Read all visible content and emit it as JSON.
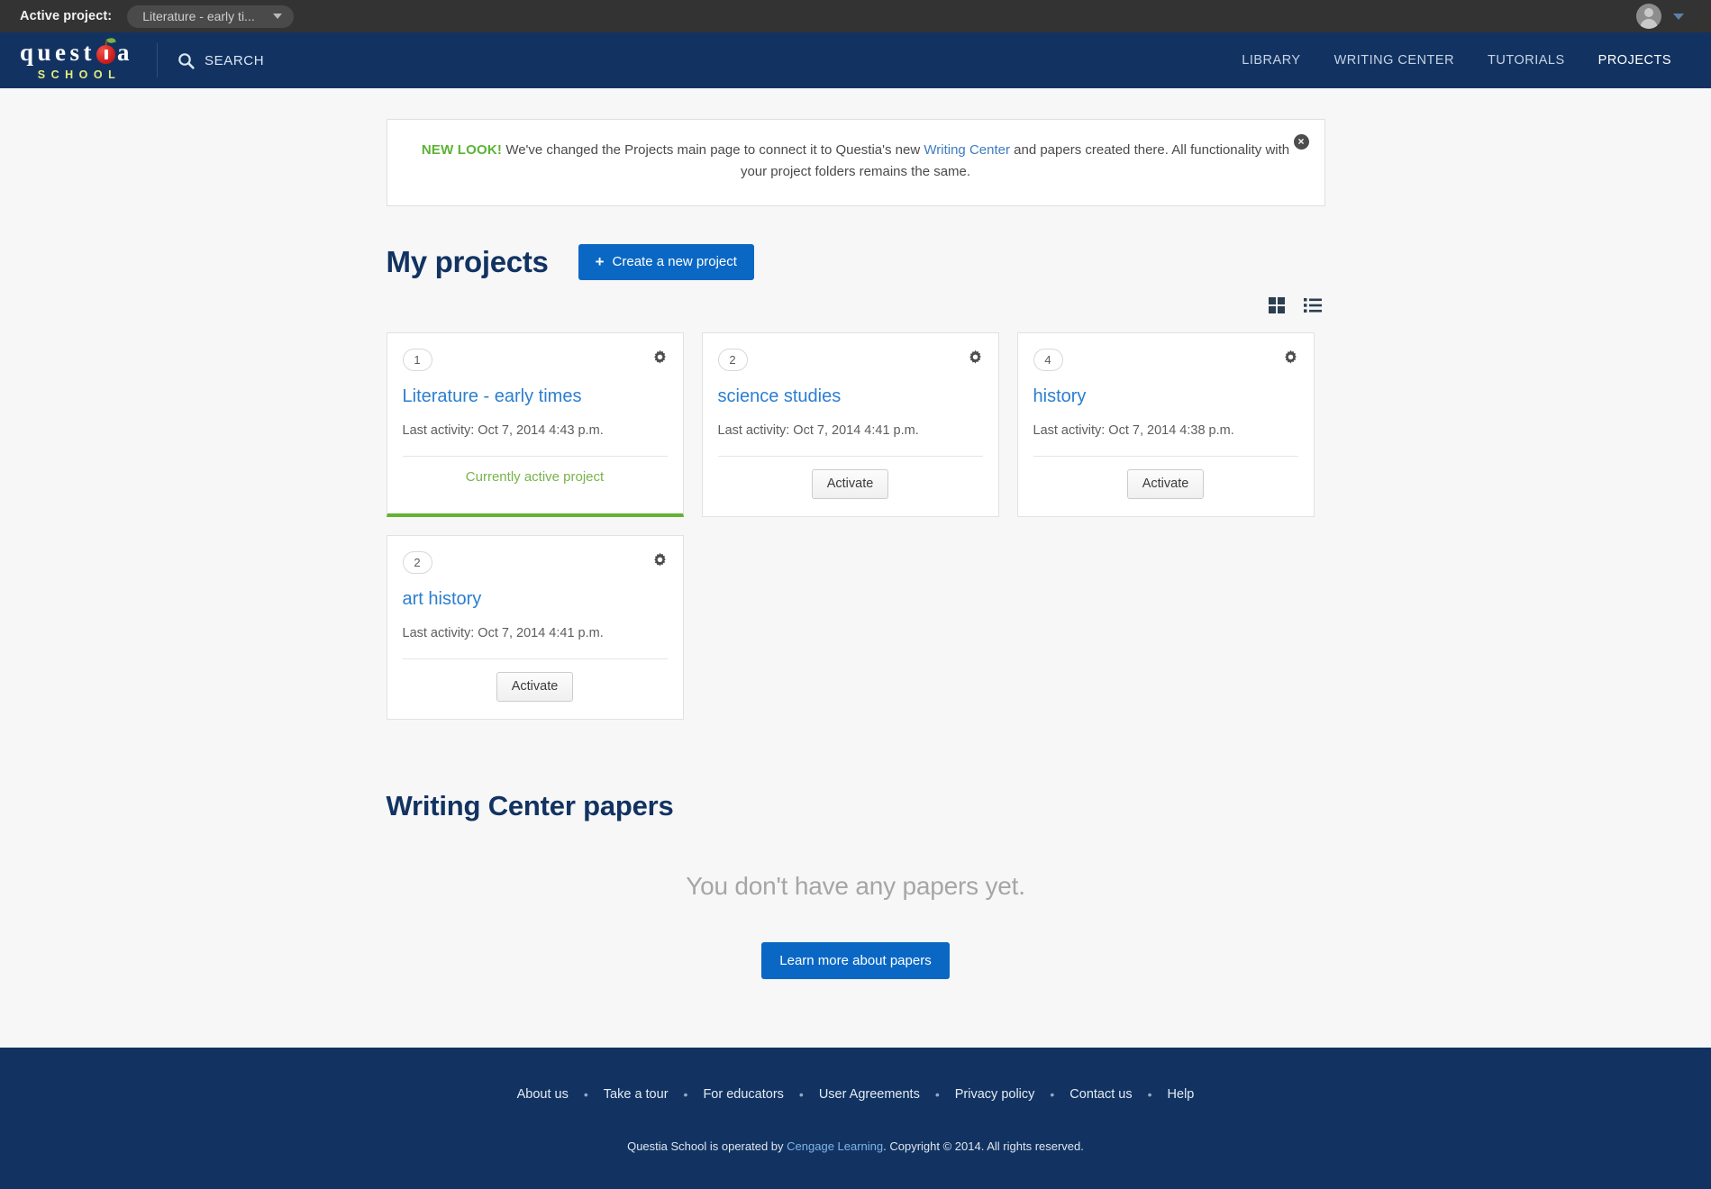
{
  "topbar": {
    "active_project_label": "Active project:",
    "active_project_value": "Literature - early ti...",
    "avatar_name": "user-avatar"
  },
  "nav": {
    "logo_word": "questia",
    "logo_sub": "SCHOOL",
    "search_label": "SEARCH",
    "items": [
      {
        "label": "LIBRARY",
        "active": false
      },
      {
        "label": "WRITING CENTER",
        "active": false
      },
      {
        "label": "TUTORIALS",
        "active": false
      },
      {
        "label": "PROJECTS",
        "active": true
      }
    ]
  },
  "banner": {
    "strong": "NEW LOOK!",
    "text_before": "We've changed the Projects main page to connect it to Questia's new",
    "link": "Writing Center",
    "text_after": "and papers created there. All functionality with your project folders remains the same.",
    "close_glyph": "×"
  },
  "projects_section": {
    "title": "My projects",
    "create_button": "Create a new project",
    "create_plus": "+",
    "view_grid": "grid-view",
    "view_list": "list-view"
  },
  "projects": [
    {
      "count": "1",
      "title": "Literature - early times",
      "last_activity": "Last activity: Oct 7, 2014 4:43 p.m.",
      "status_label": "Currently active project",
      "is_active": true
    },
    {
      "count": "2",
      "title": "science studies",
      "last_activity": "Last activity: Oct 7, 2014 4:41 p.m.",
      "action_label": "Activate",
      "is_active": false
    },
    {
      "count": "4",
      "title": "history",
      "last_activity": "Last activity: Oct 7, 2014 4:38 p.m.",
      "action_label": "Activate",
      "is_active": false
    },
    {
      "count": "2",
      "title": "art history",
      "last_activity": "Last activity: Oct 7, 2014 4:41 p.m.",
      "action_label": "Activate",
      "is_active": false
    }
  ],
  "papers_section": {
    "title": "Writing Center papers",
    "empty_message": "You don't have any papers yet.",
    "learn_button": "Learn more about papers"
  },
  "footer": {
    "links": [
      "About us",
      "Take a tour",
      "For educators",
      "User Agreements",
      "Privacy policy",
      "Contact us",
      "Help"
    ],
    "separator": "•",
    "copyright_before": "Questia School is operated by",
    "copyright_link": "Cengage Learning",
    "copyright_after": ". Copyright © 2014. All rights reserved."
  },
  "colors": {
    "navy": "#123362",
    "accent_blue": "#0a68c4",
    "green": "#64b233",
    "topbar_dark": "#333333",
    "link_blue": "#2b7ed1"
  }
}
